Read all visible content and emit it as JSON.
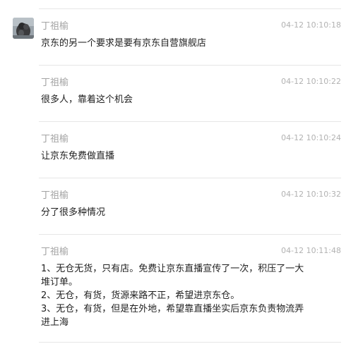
{
  "messages": [
    {
      "sender": "丁祖榆",
      "time": "04-12 10:10:18",
      "content": "京东的另一个要求是要有京东自营旗舰店",
      "show_avatar": true
    },
    {
      "sender": "丁祖榆",
      "time": "04-12 10:10:22",
      "content": "很多人，靠着这个机会",
      "show_avatar": false
    },
    {
      "sender": "丁祖榆",
      "time": "04-12 10:10:24",
      "content": "让京东免费做直播",
      "show_avatar": false
    },
    {
      "sender": "丁祖榆",
      "time": "04-12 10:10:32",
      "content": "分了很多种情况",
      "show_avatar": false
    },
    {
      "sender": "丁祖榆",
      "time": "04-12 10:11:48",
      "content": "1、无仓无货，只有店。免费让京东直播宣传了一次，积压了一大\n堆订单。\n2、无仓，有货，货源来路不正，希望进京东仓。\n3、无仓，有货，但是在外地，希望靠直播坐实后京东负责物流弄\n进上海",
      "show_avatar": false
    }
  ]
}
